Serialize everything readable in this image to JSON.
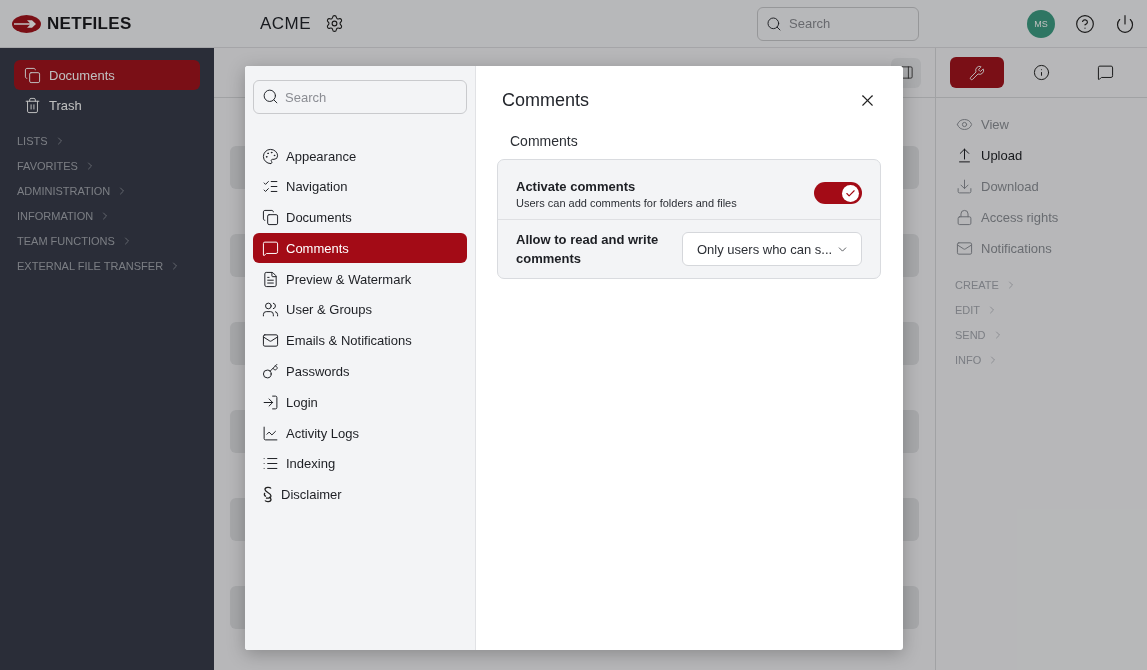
{
  "header": {
    "brand": "NETFILES",
    "workspace": "ACME",
    "search": {
      "placeholder": "Search"
    },
    "avatar": "MS"
  },
  "sidebar": {
    "items": [
      {
        "label": "Documents",
        "kind": "documents",
        "selected": true
      },
      {
        "label": "Trash",
        "kind": "trash",
        "selected": false
      }
    ],
    "sections": [
      "LISTS",
      "FAVORITES",
      "ADMINISTRATION",
      "INFORMATION",
      "TEAM FUNCTIONS",
      "EXTERNAL FILE TRANSFER"
    ]
  },
  "right_panel": {
    "tabs": [
      {
        "kind": "tools",
        "selected": true
      },
      {
        "kind": "info",
        "selected": false
      },
      {
        "kind": "comments",
        "selected": false
      }
    ],
    "actions": [
      {
        "label": "View",
        "kind": "view",
        "disabled": true
      },
      {
        "label": "Upload",
        "kind": "upload",
        "disabled": false
      },
      {
        "label": "Download",
        "kind": "download",
        "disabled": true
      },
      {
        "label": "Access rights",
        "kind": "lock",
        "disabled": true
      },
      {
        "label": "Notifications",
        "kind": "mail",
        "disabled": true
      }
    ],
    "sections": [
      "CREATE",
      "EDIT",
      "SEND",
      "INFO"
    ]
  },
  "dialog": {
    "search": {
      "placeholder": "Search"
    },
    "nav": [
      {
        "label": "Appearance",
        "kind": "palette",
        "selected": false
      },
      {
        "label": "Navigation",
        "kind": "checklist",
        "selected": false
      },
      {
        "label": "Documents",
        "kind": "documents",
        "selected": false
      },
      {
        "label": "Comments",
        "kind": "comment",
        "selected": true
      },
      {
        "label": "Preview & Watermark",
        "kind": "pdf",
        "selected": false
      },
      {
        "label": "User & Groups",
        "kind": "users",
        "selected": false
      },
      {
        "label": "Emails & Notifications",
        "kind": "mail",
        "selected": false
      },
      {
        "label": "Passwords",
        "kind": "key",
        "selected": false
      },
      {
        "label": "Login",
        "kind": "login",
        "selected": false
      },
      {
        "label": "Activity Logs",
        "kind": "activity",
        "selected": false
      },
      {
        "label": "Indexing",
        "kind": "list",
        "selected": false
      },
      {
        "label": "Disclaimer",
        "kind": "section",
        "selected": false
      }
    ],
    "title": "Comments",
    "section_heading": "Comments",
    "settings": [
      {
        "kind": "toggle",
        "label": "Activate comments",
        "description": "Users can add comments for folders and files",
        "on": true
      },
      {
        "kind": "select",
        "label": "Allow to read and write comments",
        "value": "Only users who can s..."
      }
    ]
  }
}
